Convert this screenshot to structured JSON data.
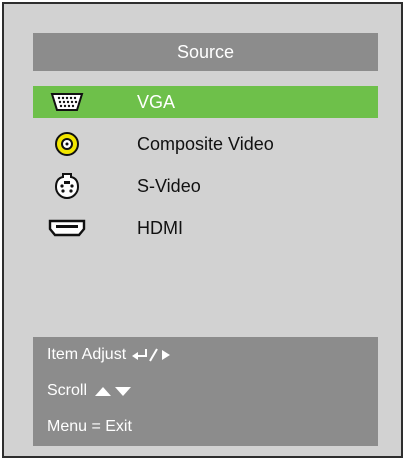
{
  "menu": {
    "title": "Source",
    "items": [
      {
        "label": "VGA",
        "icon": "vga-port-icon",
        "selected": true
      },
      {
        "label": "Composite Video",
        "icon": "composite-rca-icon",
        "selected": false
      },
      {
        "label": "S-Video",
        "icon": "s-video-port-icon",
        "selected": false
      },
      {
        "label": "HDMI",
        "icon": "hdmi-port-icon",
        "selected": false
      }
    ]
  },
  "help": {
    "item_adjust": "Item Adjust",
    "scroll": "Scroll",
    "menu_exit": "Menu = Exit"
  },
  "colors": {
    "panel": "#d2d2d2",
    "bar": "#8c8c8c",
    "selected": "#6ec04a",
    "border": "#2e2e2e",
    "composite_yellow": "#f2e600"
  }
}
